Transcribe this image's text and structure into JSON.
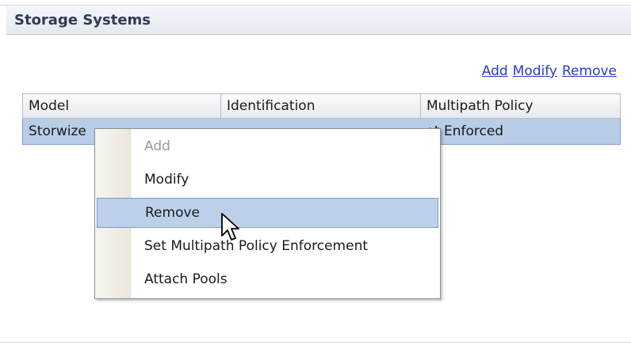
{
  "panel": {
    "title": "Storage Systems"
  },
  "actions": {
    "add": "Add",
    "modify": "Modify",
    "remove": "Remove"
  },
  "table": {
    "columns": [
      "Model",
      "Identification",
      "Multipath Policy"
    ],
    "rows": [
      {
        "model": "Storwize",
        "identification": "",
        "multipath_policy": "ot Enforced",
        "selected": true
      }
    ]
  },
  "context_menu": {
    "items": [
      {
        "label": "Add",
        "enabled": false,
        "selected": false
      },
      {
        "label": "Modify",
        "enabled": true,
        "selected": false
      },
      {
        "label": "Remove",
        "enabled": true,
        "selected": true
      },
      {
        "label": "Set Multipath Policy Enforcement",
        "enabled": true,
        "selected": false
      },
      {
        "label": "Attach Pools",
        "enabled": true,
        "selected": false
      }
    ]
  },
  "colors": {
    "header_text": "#2e3c52",
    "link": "#2a3cc4",
    "row_selected": "#b9cde6",
    "menu_selected": "#bcd0ea",
    "menu_disabled_text": "#9a9a9a"
  },
  "icons": {
    "mouse_cursor": "arrow-pointer-icon"
  }
}
